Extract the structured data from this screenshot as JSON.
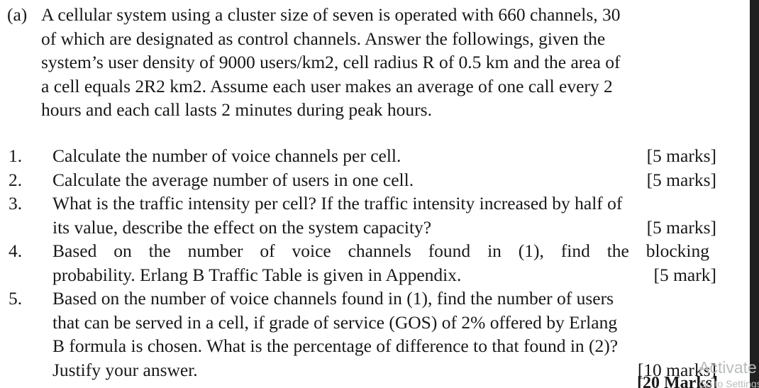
{
  "document": {
    "part_label": "(a)",
    "intro_lines": [
      "A cellular system using a cluster size of seven is operated with 660 channels, 30",
      "of which are designated as control channels. Answer the followings, given the",
      "system’s user density of 9000 users/km2, cell radius R of 0.5 km and the area of",
      "a cell equals 2R2 km2. Assume each user makes an average of one call every 2",
      "hours and each call lasts 2 minutes during peak hours."
    ],
    "questions": [
      {
        "number": "1.",
        "lines": [
          {
            "text": "Calculate the number of voice channels per cell.",
            "justify": false,
            "marks": "[5 marks]"
          }
        ]
      },
      {
        "number": "2.",
        "lines": [
          {
            "text": "Calculate the average number of users in one cell.",
            "justify": false,
            "marks": "[5 marks]"
          }
        ]
      },
      {
        "number": "3.",
        "lines": [
          {
            "text": "What is the traffic intensity per cell? If the traffic intensity increased by half of",
            "justify": false,
            "marks": ""
          },
          {
            "text": "its value, describe the effect on the system capacity?",
            "justify": false,
            "marks": "[5 marks]"
          }
        ]
      },
      {
        "number": "4.",
        "lines": [
          {
            "text": "Based on the number of voice channels found in (1), find the blocking",
            "justify": true,
            "marks": ""
          },
          {
            "text": "probability. Erlang B Traffic Table is given in Appendix.",
            "justify": false,
            "marks": "[5 mark]"
          }
        ]
      },
      {
        "number": "5.",
        "lines": [
          {
            "text": "Based on the number of voice channels found in (1), find the number of users",
            "justify": false,
            "marks": ""
          },
          {
            "text": "that can be served in a cell, if grade of service (GOS) of 2% offered by Erlang",
            "justify": false,
            "marks": ""
          },
          {
            "text": "B formula is chosen. What is the percentage of difference to that found in (2)?",
            "justify": false,
            "marks": ""
          },
          {
            "text": "Justify your answer.",
            "justify": false,
            "marks": "[10 marks]"
          }
        ]
      }
    ],
    "total_marks": "[20 Marks]"
  },
  "watermark": {
    "title": "Activate Windows",
    "subtitle": "Go to Settings to activate Windows."
  },
  "colors": {
    "text": "#181818",
    "page_background": "#ffffff",
    "right_band": "#202020",
    "watermark": "#b9bcbe"
  }
}
